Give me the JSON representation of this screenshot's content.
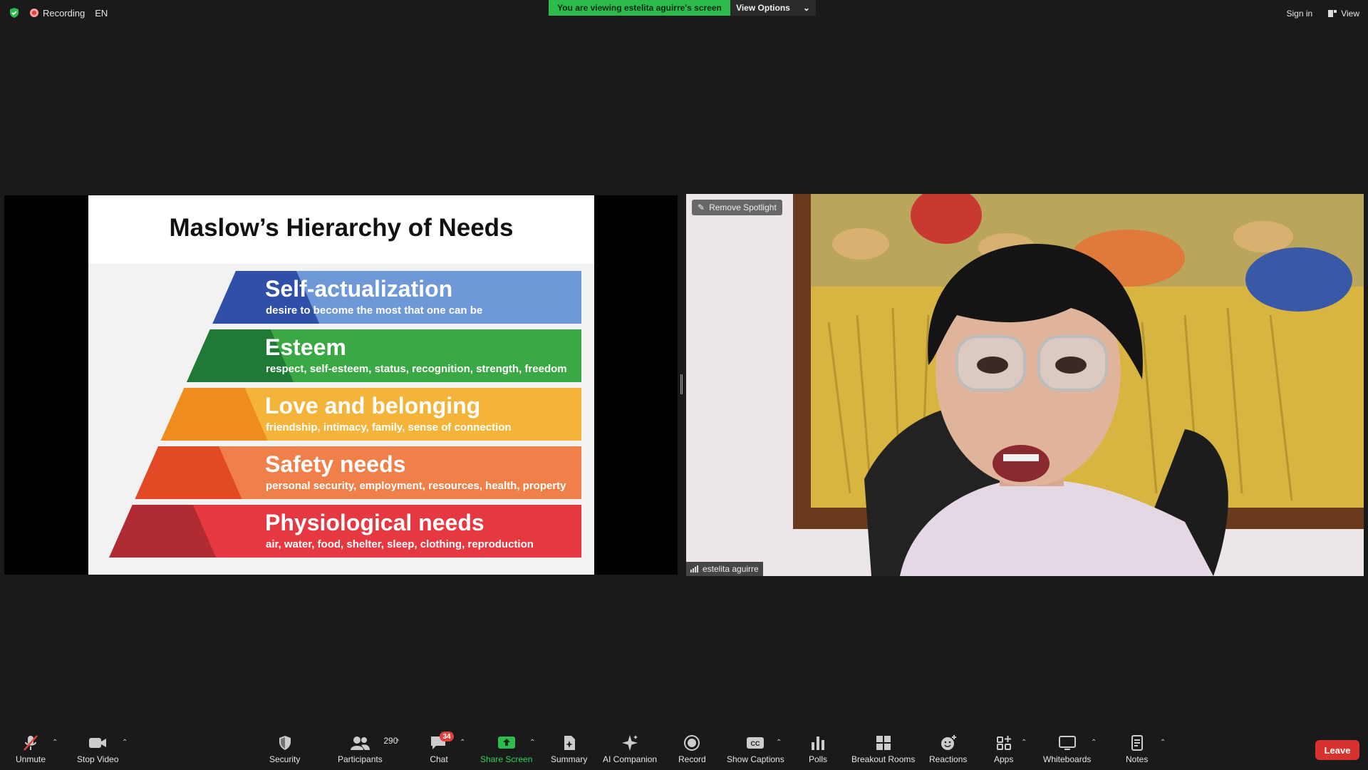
{
  "topbar": {
    "recording_label": "Recording",
    "language": "EN",
    "share_banner": "You are viewing estelita aguirre's screen",
    "view_options": "View Options",
    "sign_in": "Sign in",
    "view": "View"
  },
  "slide": {
    "title": "Maslow’s Hierarchy of Needs",
    "tiers": [
      {
        "title": "Self-actualization",
        "subtitle": "desire to become the most that one can be",
        "color": "#6f98d8",
        "dark": "#2f4fa8"
      },
      {
        "title": "Esteem",
        "subtitle": "respect, self-esteem, status, recognition, strength, freedom",
        "color": "#3aa845",
        "dark": "#1f7a35"
      },
      {
        "title": "Love and belonging",
        "subtitle": "friendship, intimacy, family, sense of connection",
        "color": "#f4b43a",
        "dark": "#ee8c1e"
      },
      {
        "title": "Safety needs",
        "subtitle": "personal security, employment, resources, health, property",
        "color": "#f0804a",
        "dark": "#e24a25"
      },
      {
        "title": "Physiological needs",
        "subtitle": "air, water, food, shelter, sleep, clothing, reproduction",
        "color": "#e63840",
        "dark": "#b02b32"
      }
    ]
  },
  "video": {
    "remove_spotlight": "Remove Spotlight",
    "participant_name": "estelita aguirre"
  },
  "toolbar": {
    "unmute": "Unmute",
    "stop_video": "Stop Video",
    "security": "Security",
    "participants": "Participants",
    "participants_count": "290",
    "chat": "Chat",
    "chat_badge": "34",
    "share_screen": "Share Screen",
    "summary": "Summary",
    "ai_companion": "AI Companion",
    "record": "Record",
    "show_captions": "Show Captions",
    "polls": "Polls",
    "breakout_rooms": "Breakout Rooms",
    "reactions": "Reactions",
    "apps": "Apps",
    "whiteboards": "Whiteboards",
    "notes": "Notes",
    "leave": "Leave"
  },
  "colors": {
    "background": "#1a1a1a",
    "share_green": "#2dbb4e",
    "leave_red": "#d8322e"
  }
}
